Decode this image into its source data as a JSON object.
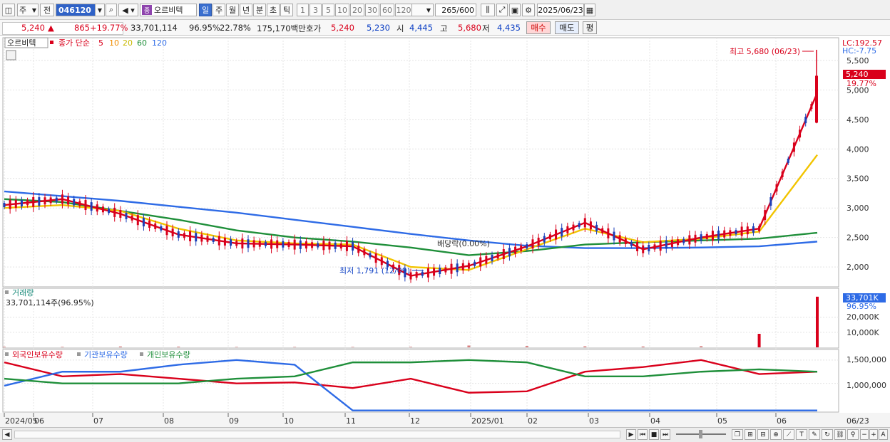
{
  "toolbar": {
    "market_label": "주",
    "prev_label": "전",
    "stock_code": "046120",
    "stock_name": "오르비텍",
    "name_badge": "종",
    "period_tabs": [
      "일",
      "주",
      "월",
      "년",
      "분",
      "초",
      "틱"
    ],
    "active_period": "일",
    "interval_buttons": [
      "1",
      "3",
      "5",
      "10",
      "20",
      "30",
      "60",
      "120"
    ],
    "count_value": "265",
    "count_total": "/600",
    "date": "2025/06/23"
  },
  "quote": {
    "price": "5,240",
    "change_arrow": "▲",
    "change": "865",
    "change_pct": "+19.77%",
    "volume": "33,701,114",
    "volume_ratio": "96.95%",
    "turnover": "22.78%",
    "amount": "175,170백만",
    "bid_label": "호가",
    "ask_price": "5,240",
    "bid_price": "5,230",
    "open_label": "시",
    "open": "4,445",
    "high_label": "고",
    "high": "5,680",
    "low_label": "저",
    "low": "4,435",
    "buy_button": "매수",
    "sell_button": "매도",
    "avg_button": "평"
  },
  "price_panel": {
    "title": "오르비텍",
    "legend_prefix": "종가 단순",
    "ma_periods": [
      "5",
      "10",
      "20",
      "60",
      "120"
    ],
    "ma_colors": [
      "#d9001b",
      "#f08c00",
      "#f2e600",
      "#1f8f3a",
      "#2e6be6"
    ],
    "lc_label": "LC:192.57",
    "hc_label": "HC:-7.75",
    "current_price_tag": "5,240",
    "current_pct_tag": "19.77%",
    "y_ticks": [
      "5,500",
      "5,000",
      "4,500",
      "4,000",
      "3,500",
      "3,000",
      "2,500",
      "2,000"
    ],
    "high_annotation": "최고 5,680 (06/23)",
    "low_annotation": "최저 1,791 (12/09)",
    "dividend_annotation": "배당락(0.00%)"
  },
  "volume_panel": {
    "title": "거래량",
    "value_text": "33,701,114주(96.95%)",
    "tag_value": "33,701K",
    "tag_pct": "96.95%",
    "y_ticks": [
      "20,000K",
      "10,000K"
    ]
  },
  "holdings_panel": {
    "legend": [
      "외국인보유수량",
      "기관보유수량",
      "개인보유수량"
    ],
    "legend_colors": [
      "#d9001b",
      "#2e6be6",
      "#1f8f3a"
    ],
    "y_ticks": [
      "1,500,000",
      "1,000,000"
    ]
  },
  "x_axis": {
    "labels": [
      "2024/05",
      "06",
      "07",
      "08",
      "09",
      "10",
      "11",
      "12",
      "2025/01",
      "02",
      "03",
      "04",
      "05",
      "06"
    ],
    "end_label": "06/23"
  },
  "chart_data": [
    {
      "type": "line",
      "title": "오르비텍",
      "x": [
        "2024/05",
        "2024/06",
        "2024/07",
        "2024/08",
        "2024/09",
        "2024/10",
        "2024/11",
        "2024/12",
        "2025/01",
        "2025/02",
        "2025/03",
        "2025/04",
        "2025/05",
        "2025/06",
        "2025/06/23"
      ],
      "series": [
        {
          "name": "5",
          "values": [
            3050,
            3150,
            2900,
            2550,
            2400,
            2380,
            2350,
            1850,
            2020,
            2350,
            2750,
            2300,
            2500,
            2650,
            4950
          ]
        },
        {
          "name": "20",
          "values": [
            3000,
            3050,
            2950,
            2650,
            2450,
            2400,
            2380,
            2000,
            1950,
            2300,
            2650,
            2420,
            2480,
            2600,
            3900
          ]
        },
        {
          "name": "60",
          "values": [
            3150,
            3100,
            2950,
            2800,
            2620,
            2500,
            2430,
            2330,
            2200,
            2270,
            2380,
            2420,
            2450,
            2480,
            2580
          ]
        },
        {
          "name": "120",
          "values": [
            3280,
            3200,
            3120,
            3020,
            2920,
            2800,
            2680,
            2560,
            2450,
            2360,
            2320,
            2320,
            2330,
            2350,
            2430
          ]
        }
      ],
      "ylim": [
        1700,
        5800
      ],
      "annotations": [
        "최고 5,680 (06/23)",
        "최저 1,791 (12/09)",
        "배당락(0.00%)"
      ]
    },
    {
      "type": "bar",
      "title": "거래량",
      "x": [
        "2024/05",
        "2024/06",
        "2024/07",
        "2024/08",
        "2024/09",
        "2024/10",
        "2024/11",
        "2024/12",
        "2025/01",
        "2025/02",
        "2025/03",
        "2025/04",
        "2025/05",
        "2025/06",
        "2025/06/23"
      ],
      "values_k": [
        400,
        350,
        600,
        500,
        300,
        300,
        300,
        350,
        1200,
        900,
        700,
        600,
        800,
        9000,
        33701
      ],
      "ylim_k": [
        0,
        36000
      ]
    },
    {
      "type": "line",
      "title": "보유수량",
      "x": [
        "2024/05",
        "2024/06",
        "2024/07",
        "2024/08",
        "2024/09",
        "2024/10",
        "2024/11",
        "2024/12",
        "2025/01",
        "2025/02",
        "2025/03",
        "2025/04",
        "2025/05",
        "2025/06",
        "2025/06/23"
      ],
      "series": [
        {
          "name": "외국인보유수량",
          "values": [
            1450000,
            1150000,
            1200000,
            1100000,
            1000000,
            1020000,
            900000,
            1100000,
            800000,
            830000,
            1250000,
            1350000,
            1500000,
            1200000,
            1250000
          ]
        },
        {
          "name": "기관보유수량",
          "values": [
            950000,
            1250000,
            1250000,
            1400000,
            1500000,
            1400000,
            420000,
            420000,
            420000,
            420000,
            420000,
            420000,
            420000,
            420000,
            420000
          ]
        },
        {
          "name": "개인보유수량",
          "values": [
            1100000,
            1000000,
            1000000,
            1000000,
            1100000,
            1150000,
            1450000,
            1450000,
            1500000,
            1450000,
            1150000,
            1150000,
            1250000,
            1300000,
            1250000
          ]
        }
      ],
      "ylim": [
        400000,
        1650000
      ]
    }
  ]
}
